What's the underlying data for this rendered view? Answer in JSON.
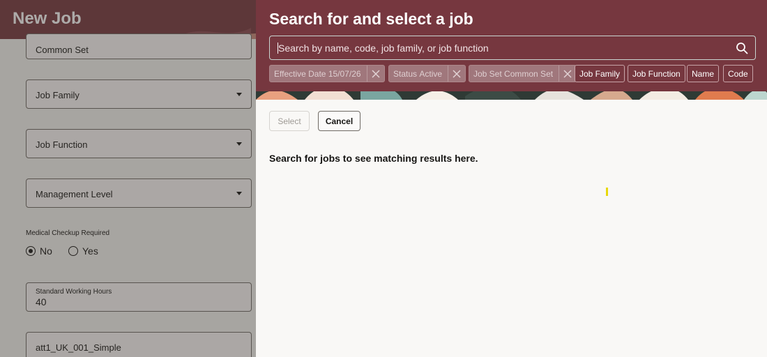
{
  "background": {
    "title": "New Job",
    "fields": {
      "job_set_value": "Common Set",
      "job_family": "Job Family",
      "job_function": "Job Function",
      "management_level": "Management Level",
      "medical_label": "Medical Checkup Required",
      "medical_no": "No",
      "medical_yes": "Yes",
      "working_hours_label": "Standard Working Hours",
      "working_hours_value": "40",
      "last_field_value": "att1_UK_001_Simple"
    }
  },
  "drawer": {
    "title": "Search for and select a job",
    "search": {
      "placeholder": "Search by name, code, job family, or job function"
    },
    "filters": [
      {
        "label": "Effective Date",
        "value": "15/07/26"
      },
      {
        "label": "Status",
        "value": "Active"
      },
      {
        "label": "Job Set",
        "value": "Common Set"
      }
    ],
    "chips": [
      "Job Family",
      "Job Function",
      "Name",
      "Code"
    ],
    "select_label": "Select",
    "cancel_label": "Cancel",
    "empty_message": "Search for jobs to see matching results here."
  },
  "colors": {
    "brand": "#76373f",
    "overlay": "rgba(60,55,50,0.42)",
    "cursor": "#e8d80a"
  }
}
